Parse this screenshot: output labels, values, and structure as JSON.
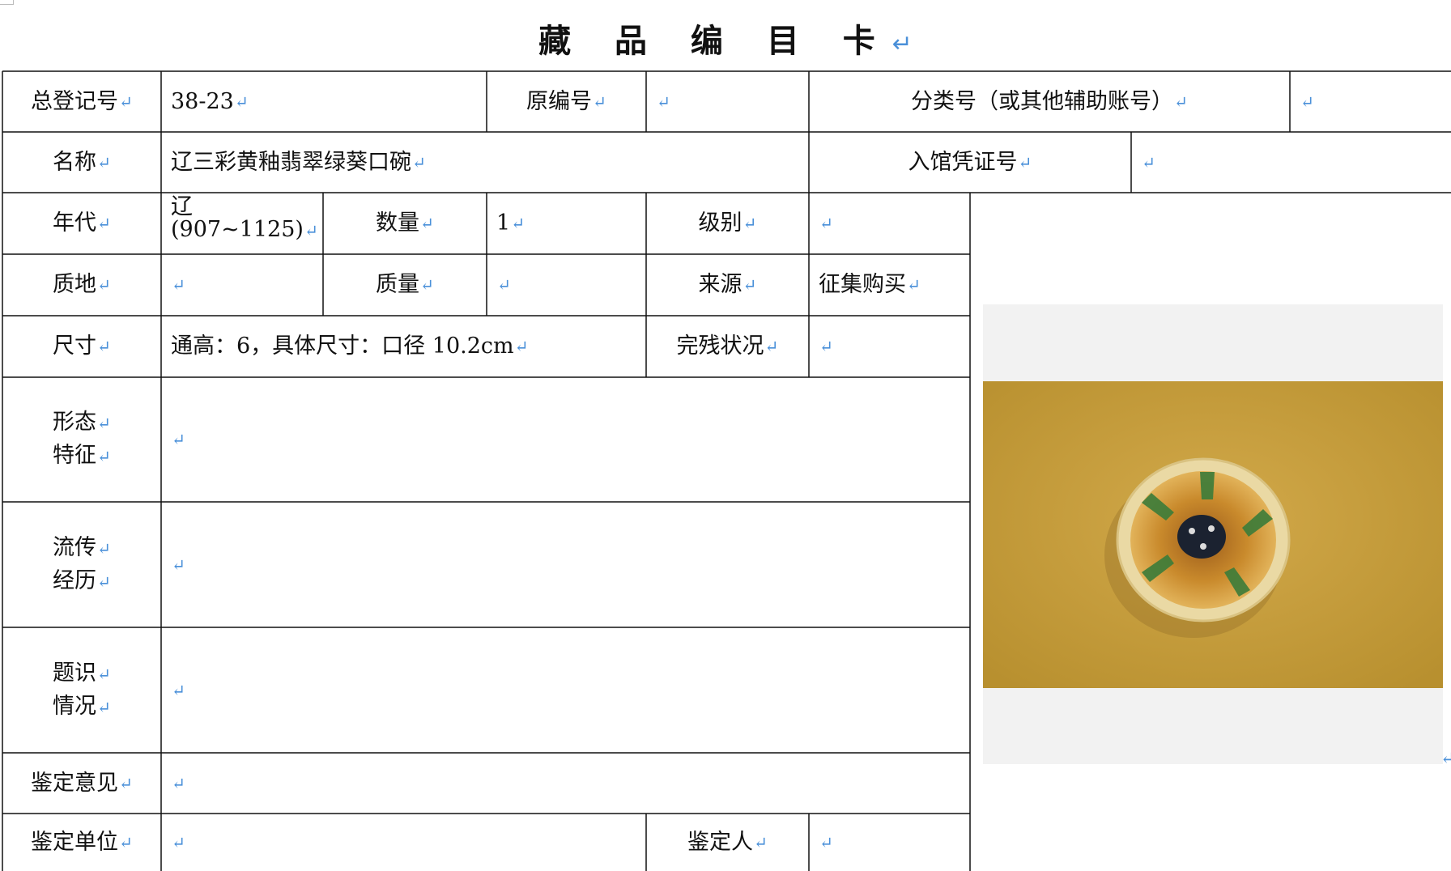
{
  "title": "藏 品 编 目 卡",
  "return_mark": "↵",
  "fields": {
    "registration_no_label": "总登记号",
    "registration_no_value": "38-23",
    "original_no_label": "原编号",
    "original_no_value": "",
    "classification_no_label": "分类号（或其他辅助账号）",
    "classification_no_value": "",
    "name_label": "名称",
    "name_value": "辽三彩黄釉翡翠绿葵口碗",
    "entry_voucher_label": "入馆凭证号",
    "entry_voucher_value": "",
    "era_label": "年代",
    "era_value_line1": "辽",
    "era_value_line2": "(907~1125)",
    "quantity_label": "数量",
    "quantity_value": "1",
    "grade_label": "级别",
    "grade_value": "",
    "material_label": "质地",
    "material_value": "",
    "mass_label": "质量",
    "mass_value": "",
    "source_label": "来源",
    "source_value": "征集购买",
    "size_label": "尺寸",
    "size_value": "通高：6，具体尺寸：口径 10.2cm",
    "condition_label": "完残状况",
    "condition_value": "",
    "form_label_1": "形态",
    "form_label_2": "特征",
    "form_value": "",
    "provenance_label_1": "流传",
    "provenance_label_2": "经历",
    "provenance_value": "",
    "inscription_label_1": "题识",
    "inscription_label_2": "情况",
    "inscription_value": "",
    "appraisal_opinion_label": "鉴定意见",
    "appraisal_opinion_value": "",
    "appraisal_unit_label": "鉴定单位",
    "appraisal_unit_value": "",
    "appraiser_label": "鉴定人",
    "appraiser_value": ""
  },
  "photo": {
    "background_color": "#c9a040",
    "bowl_rim_color": "#e8d9a8",
    "bowl_interior_color": "#c8882a",
    "green_band_color": "#3f7d3a",
    "center_color": "#1b2230"
  }
}
